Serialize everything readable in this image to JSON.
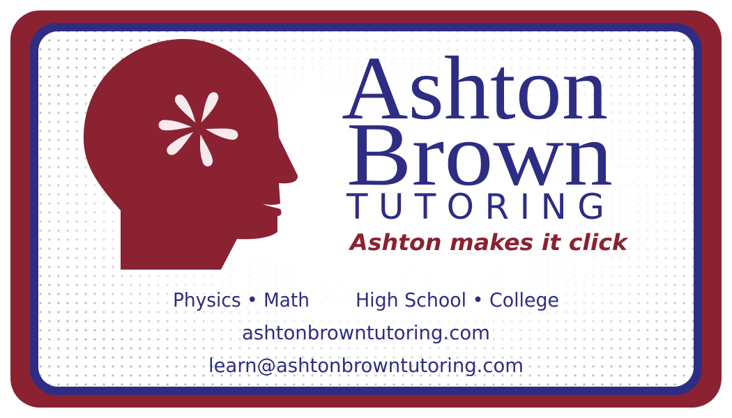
{
  "brand": {
    "name_line1": "Ashton",
    "name_line2": "Brown",
    "name_line3": "TUTORING",
    "tagline": "Ashton makes it click",
    "logo_icon": "head-silhouette-with-click-burst-icon"
  },
  "services": {
    "subjects": "Physics • Math",
    "levels": "High School • College"
  },
  "contact": {
    "website": "ashtonbrowntutoring.com",
    "email": "learn@ashtonbrowntutoring.com"
  },
  "colors": {
    "maroon": "#8a2232",
    "navy": "#2e2d84",
    "petal": "#f6eaec",
    "dots": "#a8a8a8"
  }
}
